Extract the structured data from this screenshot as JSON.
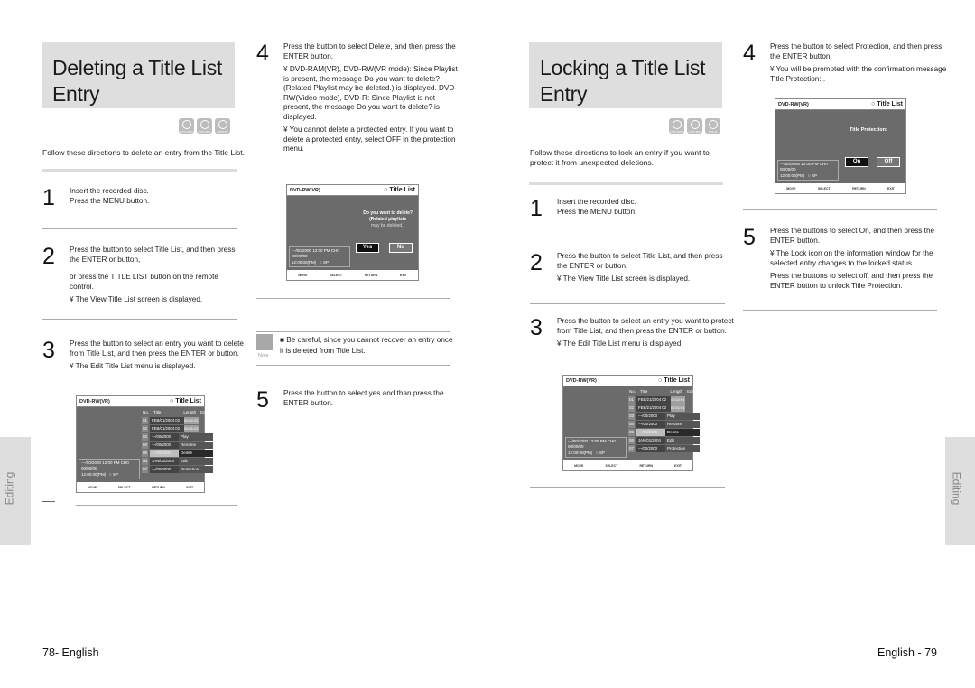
{
  "left_page": {
    "title": "Deleting a Title List Entry",
    "disc_icons": [
      "DVD-RAM",
      "DVD-RW",
      "DVD-R"
    ],
    "intro": "Follow these directions to delete an entry from the Title List.",
    "steps": [
      {
        "num": "1",
        "lines": [
          "Insert the recorded disc.",
          "Press the MENU button."
        ]
      },
      {
        "num": "2",
        "lines": [
          "Press the       button to select Title List, and then press the ENTER or    button,",
          "or press the TITLE LIST button on the remote control.",
          "¥ The View Title List screen is displayed."
        ]
      },
      {
        "num": "3",
        "lines": [
          "Press the       button to select an entry you want to delete from Title List, and then press the ENTER or      button.",
          "¥ The Edit Title List menu is displayed."
        ]
      },
      {
        "num": "4",
        "lines": [
          "Press the       button to select Delete, and then press the ENTER button.",
          "¥ DVD-RAM(VR), DVD-RW(VR mode): Since Playlist is present, the message  Do you want to delete? (Related Playlist may be deleted.)  is displayed. DVD-RW(Video mode), DVD-R: Since Playlist is not present, the message  Do you want to delete?  is displayed.",
          "¥ You cannot delete a protected entry. If you want to delete a protected entry, select  OFF  in the protection menu."
        ]
      },
      {
        "num": "5",
        "lines": [
          "Press the       button to select yes and than press the ENTER button."
        ]
      }
    ],
    "note": {
      "label": "Note",
      "text": "■ Be careful, since you cannot recover an entry once it is deleted from Title List."
    },
    "side_tab": "Editing",
    "footer": "78- English"
  },
  "right_page": {
    "title": "Locking a Title List Entry",
    "disc_icons": [
      "DVD-RAM",
      "DVD-RW",
      "DVD-R"
    ],
    "intro": "Follow these directions to lock an entry if you want to protect it from unexpected deletions.",
    "steps": [
      {
        "num": "1",
        "lines": [
          "Insert the recorded disc.",
          "Press the MENU button."
        ]
      },
      {
        "num": "2",
        "lines": [
          "Press the       button to select Title List, and then press the ENTER or    button.",
          "¥ The View Title List screen is displayed."
        ]
      },
      {
        "num": "3",
        "lines": [
          "Press the       button to select an entry you want to protect from Title List, and then press the ENTER or      button.",
          "¥ The Edit Title List menu is displayed."
        ]
      },
      {
        "num": "4",
        "lines": [
          "Press the       button to select Protection, and then press the ENTER button.",
          "¥ You will be prompted with the confirmation message  Title Protection: ."
        ]
      },
      {
        "num": "5",
        "lines": [
          "Press the       buttons to select On, and then press the ENTER button.",
          "¥ The Lock icon on the information window for the selected entry changes to the locked status.",
          "Press the       buttons to select off, and then press the ENTER button to unlock Title Protection."
        ]
      }
    ],
    "side_tab": "Editing",
    "footer": "English - 79"
  },
  "screens": {
    "header_left": "DVD-RW(VR)",
    "header_right": "○ Title List",
    "info": [
      "---/00/2000 12:00 PM CH0",
      "00/00/00",
      "12:00:00(PM)",
      "SP"
    ],
    "footer_items": [
      "MOVE",
      "SELECT",
      "RETURN",
      "EXIT"
    ],
    "table_headers": [
      "No.",
      "Title",
      "Length",
      "Edit"
    ],
    "edit_list_left": {
      "rows": [
        {
          "no": "01",
          "title": "FEB/01/2004 02",
          "length": "00:02:01"
        },
        {
          "no": "02",
          "title": "FEB/01/2004 02",
          "length": "00:01:01"
        },
        {
          "no": "03",
          "title": "---/00/2000",
          "length": ""
        },
        {
          "no": "04",
          "title": "---/00/2000",
          "length": ""
        },
        {
          "no": "05",
          "title": "---/00/2000",
          "length": ""
        },
        {
          "no": "06",
          "title": "JAN/01/2004",
          "length": ""
        },
        {
          "no": "07",
          "title": "---/00/2000",
          "length": ""
        }
      ],
      "menu": [
        "Play",
        "Rename",
        "Delete",
        "Edit",
        "Protection"
      ],
      "selected_menu": "Delete"
    },
    "edit_list_right": {
      "rows": [
        {
          "no": "01",
          "title": "FEB/21/2004 02",
          "length": "00:02:01"
        },
        {
          "no": "02",
          "title": "FEB/21/2004 02",
          "length": "00:01:01"
        },
        {
          "no": "03",
          "title": "---/00/2000",
          "length": ""
        },
        {
          "no": "04",
          "title": "---/00/2000",
          "length": ""
        },
        {
          "no": "05",
          "title": "---/00/2000",
          "length": ""
        },
        {
          "no": "06",
          "title": "JAN/01/2004",
          "length": ""
        },
        {
          "no": "07",
          "title": "---/00/2000",
          "length": ""
        }
      ],
      "menu": [
        "Play",
        "Rename",
        "Delete",
        "Edit",
        "Protection"
      ],
      "selected_menu": "Delete"
    },
    "delete_dialog": {
      "message": [
        "Do you want to delete?",
        "(Related playlists",
        "may be deleted.)"
      ],
      "yes": "Yes",
      "no": "No"
    },
    "protect_dialog": {
      "message": "Title Protection:",
      "on": "On",
      "off": "Off"
    }
  }
}
